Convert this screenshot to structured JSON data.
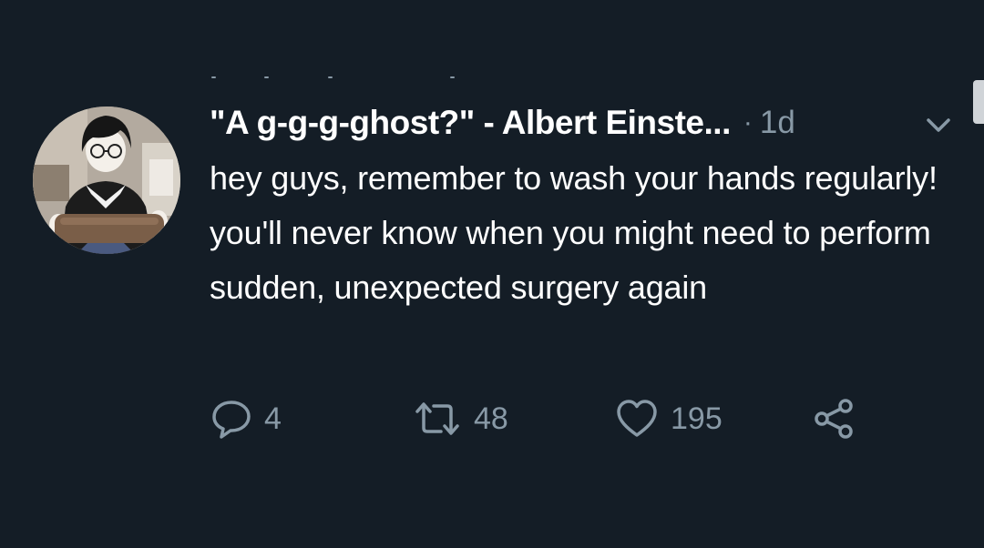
{
  "tweet": {
    "display_name": "\"A g-g-g-ghost?\" - Albert Einste...",
    "separator": "·",
    "timestamp": "1d",
    "text": "hey guys, remember to wash your hands regularly! you'll never know when you might need to perform sudden, unexpected surgery again"
  },
  "actions": {
    "replies": "4",
    "retweets": "48",
    "likes": "195"
  },
  "icons": {
    "reply": "reply-icon",
    "retweet": "retweet-icon",
    "like": "heart-icon",
    "share": "share-icon",
    "menu": "chevron-down-icon"
  },
  "colors": {
    "background": "#141d26",
    "text": "#ffffff",
    "secondary": "#8899a6"
  }
}
